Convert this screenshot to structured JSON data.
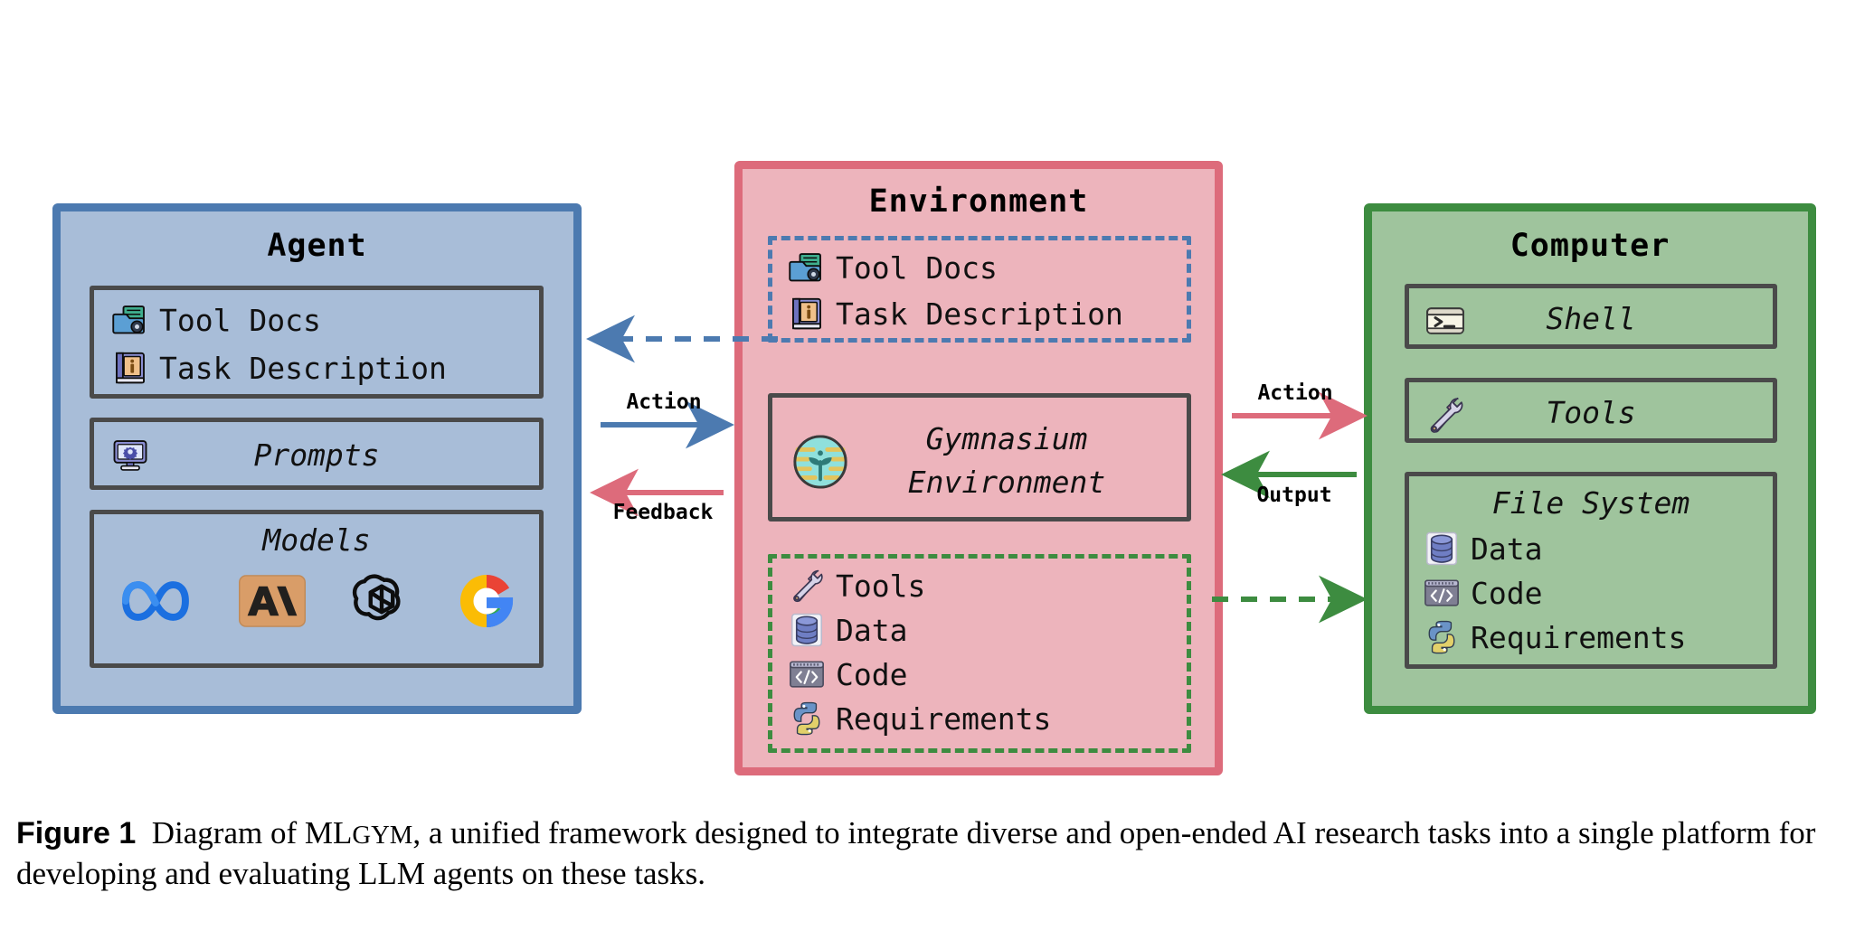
{
  "figure": {
    "label": "Figure 1",
    "caption_part1": "Diagram of ML",
    "caption_smallcaps": "Gym",
    "caption_part2": ", a unified framework designed to integrate diverse and open-ended AI research tasks into a single platform for developing and evaluating LLM agents on these tasks.",
    "full_caption": "Figure 1  Diagram of MLGym, a unified framework designed to integrate diverse and open-ended AI research tasks into a single platform for developing and evaluating LLM agents on these tasks."
  },
  "colors": {
    "agent_border": "#4c7ab0",
    "agent_fill": "#a8bdd8",
    "environment_border": "#dd6b7b",
    "environment_fill": "#edb4bc",
    "computer_border": "#3d8c40",
    "computer_fill": "#9fc49d",
    "card_border": "#4a4a4a",
    "action_arrow_left": "#4c7ab0",
    "feedback_arrow": "#dd6b7b",
    "action_arrow_right": "#dd6b7b",
    "output_arrow": "#3d8c40"
  },
  "agent": {
    "title": "Agent",
    "inputs_card": {
      "items": [
        {
          "icon": "tool-docs-icon",
          "label": "Tool Docs"
        },
        {
          "icon": "task-description-icon",
          "label": "Task Description"
        }
      ]
    },
    "prompts_card": {
      "icon": "prompts-monitor-icon",
      "label": "Prompts"
    },
    "models_card": {
      "heading": "Models",
      "logos": [
        {
          "name": "meta-logo",
          "label": "Meta"
        },
        {
          "name": "anthropic-logo",
          "label": "Anthropic"
        },
        {
          "name": "openai-logo",
          "label": "OpenAI"
        },
        {
          "name": "google-logo",
          "label": "Google"
        }
      ]
    }
  },
  "environment": {
    "title": "Environment",
    "docs_card": {
      "items": [
        {
          "icon": "tool-docs-icon",
          "label": "Tool Docs"
        },
        {
          "icon": "task-description-icon",
          "label": "Task Description"
        }
      ]
    },
    "gymnasium_card": {
      "icon": "gymnasium-logo",
      "label_line1": "Gymnasium",
      "label_line2": "Environment"
    },
    "resources_card": {
      "items": [
        {
          "icon": "tools-icon",
          "label": "Tools"
        },
        {
          "icon": "data-icon",
          "label": "Data"
        },
        {
          "icon": "code-icon",
          "label": "Code"
        },
        {
          "icon": "requirements-python-icon",
          "label": "Requirements"
        }
      ]
    }
  },
  "computer": {
    "title": "Computer",
    "shell_card": {
      "icon": "shell-icon",
      "label": "Shell"
    },
    "tools_card": {
      "icon": "tools-icon",
      "label": "Tools"
    },
    "filesystem_card": {
      "heading": "File System",
      "items": [
        {
          "icon": "data-icon",
          "label": "Data"
        },
        {
          "icon": "code-icon",
          "label": "Code"
        },
        {
          "icon": "requirements-python-icon",
          "label": "Requirements"
        }
      ]
    }
  },
  "connectors": [
    {
      "id": "agent-to-env-action",
      "label": "Action",
      "style": "solid",
      "color": "#4c7ab0",
      "direction": "right"
    },
    {
      "id": "env-to-agent-feedback",
      "label": "Feedback",
      "style": "solid",
      "color": "#dd6b7b",
      "direction": "left"
    },
    {
      "id": "env-to-agent-docs",
      "label": "",
      "style": "dashed",
      "color": "#4c7ab0",
      "direction": "left"
    },
    {
      "id": "env-to-computer-action",
      "label": "Action",
      "style": "solid",
      "color": "#dd6b7b",
      "direction": "right"
    },
    {
      "id": "computer-to-env-output",
      "label": "Output",
      "style": "solid",
      "color": "#3d8c40",
      "direction": "left"
    },
    {
      "id": "env-to-computer-resources",
      "label": "",
      "style": "dashed",
      "color": "#3d8c40",
      "direction": "right"
    }
  ]
}
